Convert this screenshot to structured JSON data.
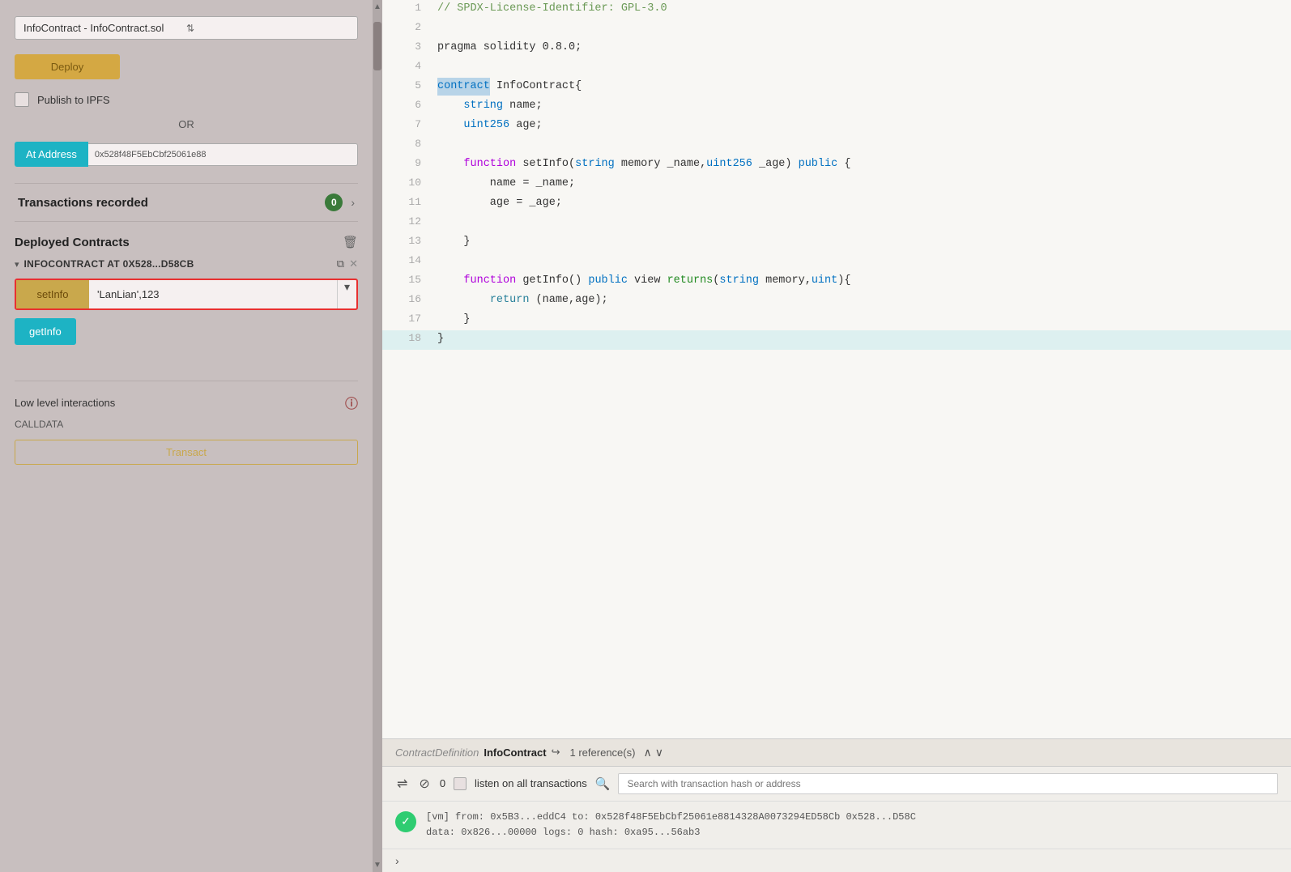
{
  "left_panel": {
    "contract_selector": {
      "label": "InfoContract - InfoContract.sol",
      "arrows": "⇅"
    },
    "deploy_button": "Deploy",
    "publish_ipfs": {
      "label": "Publish to IPFS",
      "checked": false
    },
    "or_text": "OR",
    "at_address": {
      "button": "At Address",
      "value": "0x528f48F5EbCbf25061e88"
    },
    "transactions": {
      "label": "Transactions recorded",
      "count": "0"
    },
    "deployed_contracts": {
      "title": "Deployed Contracts",
      "instances": [
        {
          "name": "INFOCONTRACT AT 0X528...D58CB",
          "functions": [
            {
              "name": "setInfo",
              "input": "'LanLian',123",
              "type": "orange"
            },
            {
              "name": "getInfo",
              "type": "blue"
            }
          ]
        }
      ]
    },
    "low_level": {
      "title": "Low level interactions",
      "calldata": "CALLDATA",
      "transact": "Transact"
    }
  },
  "code_editor": {
    "lines": [
      {
        "num": 1,
        "tokens": [
          {
            "text": "// SPDX-License-Identifier: GPL-3.0",
            "class": "c-comment"
          }
        ]
      },
      {
        "num": 2,
        "tokens": []
      },
      {
        "num": 3,
        "tokens": [
          {
            "text": "pragma solidity 0.8.0;",
            "class": "c-plain"
          }
        ]
      },
      {
        "num": 4,
        "tokens": []
      },
      {
        "num": 5,
        "tokens": [
          {
            "text": "contract",
            "class": "c-keyword"
          },
          {
            "text": " InfoContract{",
            "class": "c-plain"
          }
        ],
        "selected": true
      },
      {
        "num": 6,
        "tokens": [
          {
            "text": "    string",
            "class": "c-keyword"
          },
          {
            "text": " name;",
            "class": "c-plain"
          }
        ]
      },
      {
        "num": 7,
        "tokens": [
          {
            "text": "    uint256",
            "class": "c-keyword"
          },
          {
            "text": " age;",
            "class": "c-plain"
          }
        ]
      },
      {
        "num": 8,
        "tokens": []
      },
      {
        "num": 9,
        "tokens": [
          {
            "text": "    function",
            "class": "c-keyword2"
          },
          {
            "text": " setInfo(",
            "class": "c-plain"
          },
          {
            "text": "string",
            "class": "c-keyword"
          },
          {
            "text": " memory _name,",
            "class": "c-plain"
          },
          {
            "text": "uint256",
            "class": "c-keyword"
          },
          {
            "text": " _age) ",
            "class": "c-plain"
          },
          {
            "text": "public",
            "class": "c-keyword"
          },
          {
            "text": " {",
            "class": "c-plain"
          }
        ]
      },
      {
        "num": 10,
        "tokens": [
          {
            "text": "        name = _name;",
            "class": "c-plain"
          }
        ]
      },
      {
        "num": 11,
        "tokens": [
          {
            "text": "        age = _age;",
            "class": "c-plain"
          }
        ]
      },
      {
        "num": 12,
        "tokens": []
      },
      {
        "num": 13,
        "tokens": [
          {
            "text": "    }",
            "class": "c-plain"
          }
        ]
      },
      {
        "num": 14,
        "tokens": []
      },
      {
        "num": 15,
        "tokens": [
          {
            "text": "    function",
            "class": "c-keyword2"
          },
          {
            "text": " getInfo() ",
            "class": "c-plain"
          },
          {
            "text": "public",
            "class": "c-keyword"
          },
          {
            "text": " view ",
            "class": "c-plain"
          },
          {
            "text": "returns",
            "class": "c-green"
          },
          {
            "text": "(",
            "class": "c-plain"
          },
          {
            "text": "string",
            "class": "c-keyword"
          },
          {
            "text": " memory,",
            "class": "c-plain"
          },
          {
            "text": "uint",
            "class": "c-keyword"
          },
          {
            "text": "){",
            "class": "c-plain"
          }
        ]
      },
      {
        "num": 16,
        "tokens": [
          {
            "text": "        ",
            "class": "c-plain"
          },
          {
            "text": "return",
            "class": "c-return"
          },
          {
            "text": " (name,age);",
            "class": "c-plain"
          }
        ]
      },
      {
        "num": 17,
        "tokens": [
          {
            "text": "    }",
            "class": "c-plain"
          }
        ]
      },
      {
        "num": 18,
        "tokens": [
          {
            "text": "}",
            "class": "c-plain"
          }
        ],
        "highlighted": true
      }
    ]
  },
  "bottom_bar": {
    "contract_def": {
      "def_label": "ContractDefinition",
      "name": "InfoContract",
      "ref_text": "1 reference(s)"
    },
    "toolbar": {
      "count": "0",
      "listen_label": "listen on all transactions",
      "search_placeholder": "Search with transaction hash or address"
    },
    "transaction": {
      "from": "[vm] from: 0x5B3...eddC4 to: 0x528f48F5EbCbf25061e8814328A0073294ED58Cb 0x528...D58C",
      "data": "data: 0x826...00000 logs: 0 hash: 0xa95...56ab3"
    }
  },
  "icons": {
    "chevron_right": "›",
    "chevron_down": "▾",
    "trash": "🗑",
    "copy": "⧉",
    "close": "✕",
    "info": "ℹ",
    "check": "✓",
    "arrow_left": "‹",
    "caret_down": "▾",
    "scroll_up": "▲",
    "scroll_down": "▼",
    "arrow_icon": "↪",
    "up_arrow": "∧",
    "down_arrow": "∨",
    "search": "🔍",
    "double_arrow": "⇌",
    "no_symbol": "⊘",
    "footer_arrow": "›"
  }
}
